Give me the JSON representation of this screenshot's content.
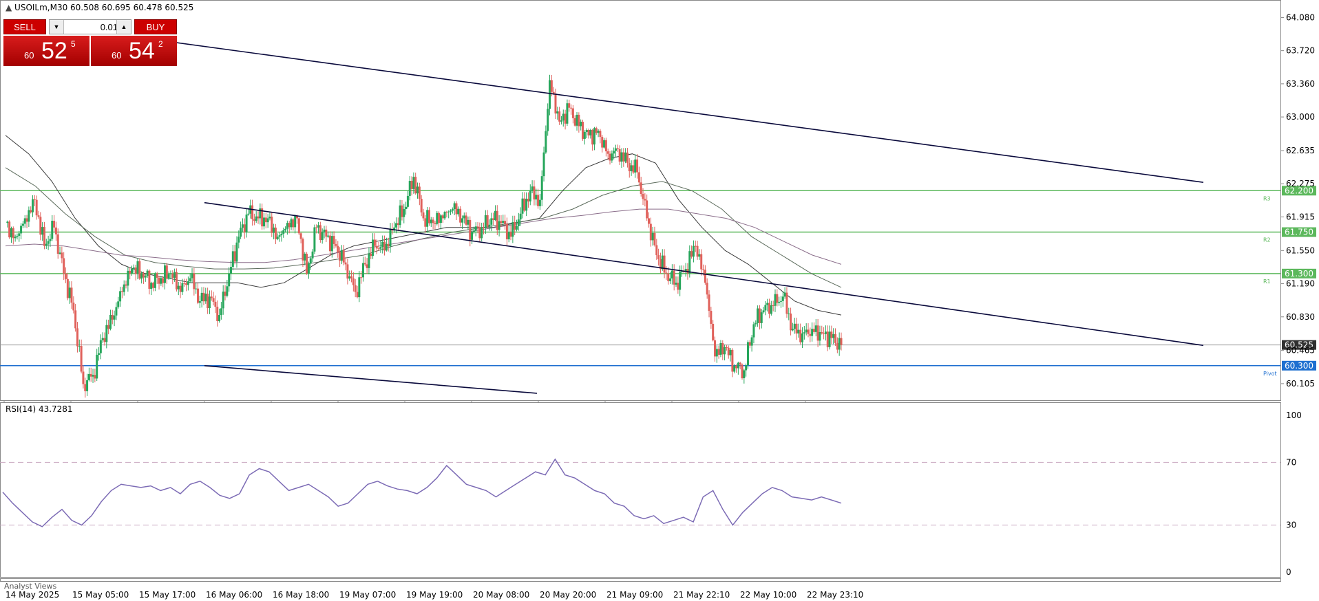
{
  "header": {
    "symbol_text": "USOILm,M30",
    "ohlc_text": "60.508 60.695 60.478 60.525"
  },
  "trade_panel": {
    "sell_label": "SELL",
    "buy_label": "BUY",
    "lot_value": "0.01",
    "sell_price": {
      "big_figure": "60",
      "pips": "52",
      "fraction": "5"
    },
    "buy_price": {
      "big_figure": "60",
      "pips": "54",
      "fraction": "2"
    }
  },
  "price_axis": {
    "ticks": [
      "64.080",
      "63.720",
      "63.360",
      "63.000",
      "62.635",
      "62.275",
      "61.915",
      "61.550",
      "61.190",
      "60.830",
      "60.465",
      "60.105"
    ],
    "tick_values": [
      64.08,
      63.72,
      63.36,
      63.0,
      62.635,
      62.275,
      61.915,
      61.55,
      61.19,
      60.83,
      60.465,
      60.105
    ],
    "range": [
      59.94,
      64.24
    ]
  },
  "levels": [
    {
      "price": 62.2,
      "label": "62.200",
      "tag": "R3",
      "color": "#5cb85c"
    },
    {
      "price": 61.75,
      "label": "61.750",
      "tag": "R2",
      "color": "#5cb85c"
    },
    {
      "price": 61.3,
      "label": "61.300",
      "tag": "R1",
      "color": "#5cb85c"
    },
    {
      "price": 60.3,
      "label": "60.300",
      "tag": "Pivot",
      "color": "#1e6fd0"
    }
  ],
  "current_price": {
    "price": 60.525,
    "label": "60.525",
    "color": "#303030"
  },
  "rsi": {
    "title": "RSI(14) 43.7281",
    "levels": [
      "100",
      "70",
      "30",
      "0"
    ],
    "level_values": [
      100,
      70,
      30,
      0
    ],
    "color": "#7c6bb5"
  },
  "time_axis": {
    "labels": [
      "14 May 2025",
      "15 May 05:00",
      "15 May 17:00",
      "16 May 06:00",
      "16 May 18:00",
      "19 May 07:00",
      "19 May 19:00",
      "20 May 08:00",
      "20 May 20:00",
      "21 May 09:00",
      "21 May 22:10",
      "22 May 10:00",
      "22 May 23:10"
    ]
  },
  "footer": {
    "analyst_views": "Analyst Views"
  },
  "colors": {
    "bull": "#26a65b",
    "bear": "#e0605a",
    "trendline": "#0a0a3c",
    "ma_fast": "#3a3a3a",
    "ma_slow": "#8a6d8a"
  },
  "chart_data": {
    "type": "candlestick",
    "title": "USOILm,M30",
    "path": [
      61.85,
      61.7,
      61.9,
      62.1,
      61.6,
      61.8,
      61.3,
      60.9,
      60.1,
      60.2,
      60.6,
      60.8,
      61.1,
      61.35,
      61.3,
      61.2,
      61.25,
      61.3,
      61.1,
      61.25,
      61.0,
      61.05,
      60.85,
      61.3,
      61.7,
      61.95,
      61.9,
      61.9,
      61.7,
      61.85,
      61.9,
      61.3,
      61.8,
      61.7,
      61.6,
      61.4,
      61.1,
      61.4,
      61.6,
      61.55,
      61.8,
      62.0,
      62.35,
      61.9,
      61.85,
      61.9,
      62.0,
      61.9,
      61.75,
      61.8,
      61.9,
      61.85,
      61.7,
      61.95,
      62.2,
      62.1,
      63.4,
      62.95,
      63.1,
      62.9,
      62.8,
      62.85,
      62.6,
      62.65,
      62.5,
      62.4,
      61.9,
      61.5,
      61.3,
      61.2,
      61.35,
      61.6,
      61.2,
      60.4,
      60.5,
      60.3,
      60.25,
      60.75,
      60.9,
      60.95,
      61.05,
      60.7,
      60.65,
      60.7,
      60.65,
      60.6,
      60.525
    ],
    "ma_fast": [
      62.8,
      62.6,
      62.3,
      61.9,
      61.6,
      61.4,
      61.3,
      61.25,
      61.2,
      61.2,
      61.2,
      61.15,
      61.2,
      61.35,
      61.5,
      61.6,
      61.65,
      61.7,
      61.75,
      61.8,
      61.8,
      61.8,
      61.85,
      61.9,
      62.2,
      62.45,
      62.55,
      62.6,
      62.5,
      62.1,
      61.8,
      61.55,
      61.4,
      61.2,
      61.0,
      60.9,
      60.85
    ],
    "ma_slow": [
      61.6,
      61.62,
      61.6,
      61.55,
      61.5,
      61.48,
      61.45,
      61.43,
      61.42,
      61.42,
      61.45,
      61.5,
      61.55,
      61.6,
      61.65,
      61.7,
      61.75,
      61.8,
      61.85,
      61.9,
      61.93,
      61.97,
      62.0,
      62.0,
      61.95,
      61.9,
      61.8,
      61.65,
      61.5,
      61.4
    ],
    "ma_mid": [
      62.45,
      62.25,
      61.95,
      61.7,
      61.5,
      61.42,
      61.38,
      61.35,
      61.35,
      61.36,
      61.4,
      61.45,
      61.5,
      61.6,
      61.68,
      61.75,
      61.8,
      61.85,
      61.9,
      62.0,
      62.15,
      62.25,
      62.3,
      62.2,
      62.0,
      61.7,
      61.5,
      61.3,
      61.15
    ],
    "rsi_values": [
      51,
      44,
      38,
      32,
      29,
      35,
      40,
      33,
      30,
      36,
      45,
      52,
      56,
      55,
      54,
      55,
      52,
      54,
      50,
      56,
      58,
      54,
      49,
      47,
      50,
      62,
      66,
      64,
      58,
      52,
      54,
      56,
      52,
      48,
      42,
      44,
      50,
      56,
      58,
      55,
      53,
      52,
      50,
      54,
      60,
      68,
      62,
      56,
      54,
      52,
      48,
      52,
      56,
      60,
      64,
      62,
      72,
      62,
      60,
      56,
      52,
      50,
      44,
      42,
      36,
      34,
      36,
      31,
      33,
      35,
      32,
      48,
      52,
      40,
      30,
      38,
      44,
      50,
      54,
      52,
      48,
      47,
      46,
      48,
      46,
      44
    ],
    "trendlines": [
      {
        "from_price": 63.85,
        "to_price": 62.29,
        "from_label": "15 May 17:00",
        "to_label": "22 May 23:10"
      },
      {
        "from_price": 62.07,
        "to_price": 60.52,
        "from_label": "16 May 06:00",
        "to_label": "22 May 23:10"
      },
      {
        "from_price": 60.3,
        "to_price": 60.0,
        "from_label": "16 May 06:00",
        "to_label": "20 May 08:00"
      }
    ]
  }
}
